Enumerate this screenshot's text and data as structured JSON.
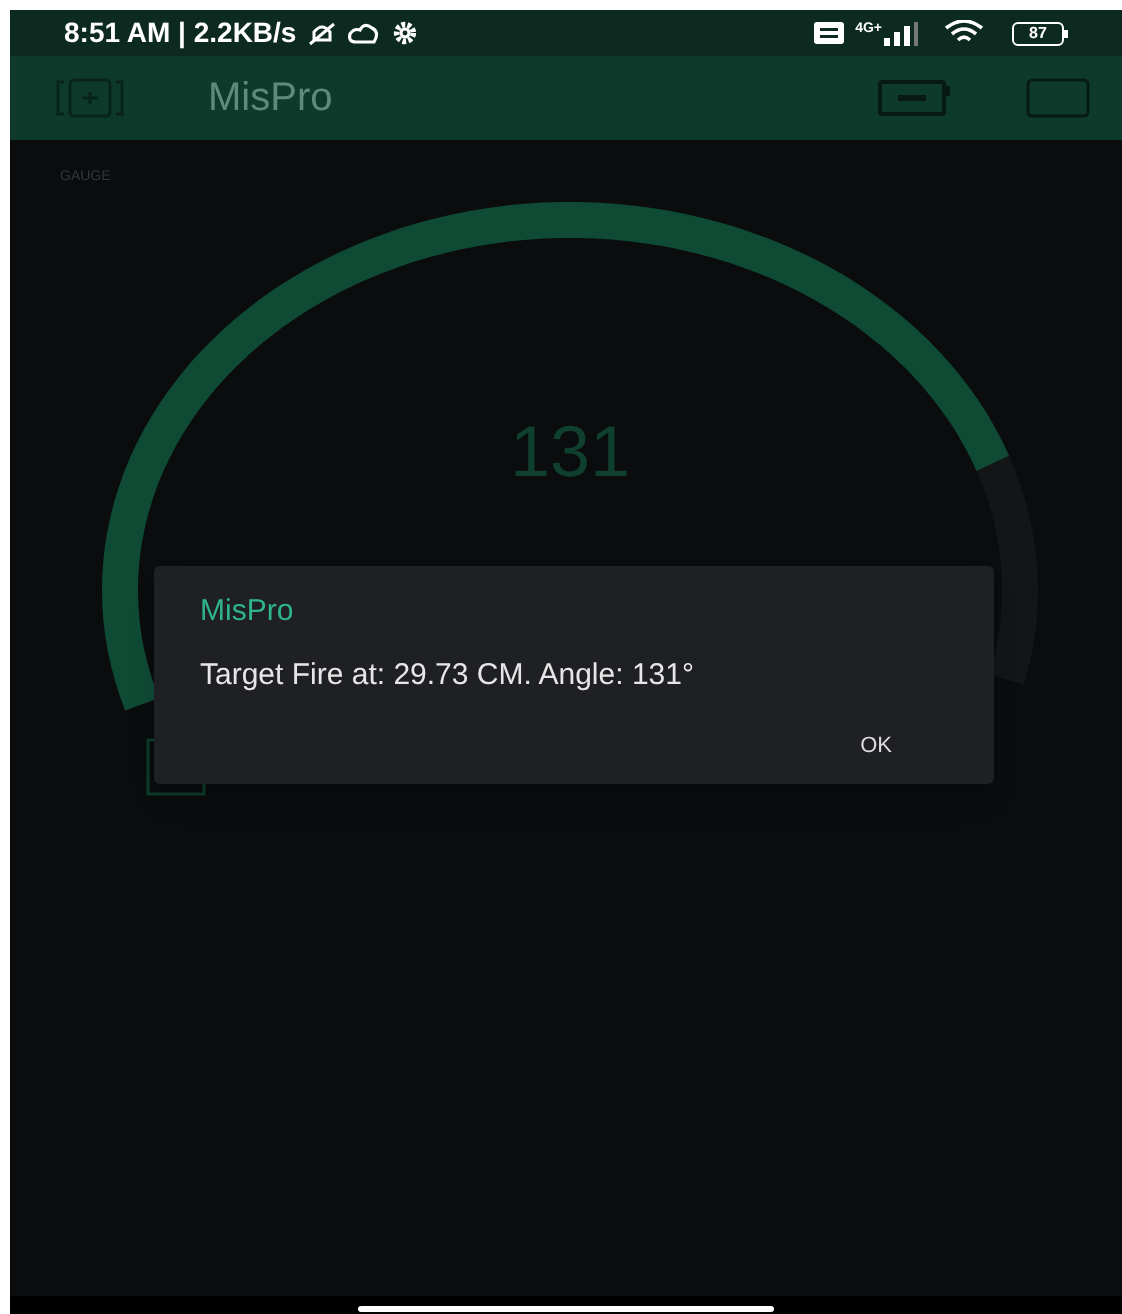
{
  "status_bar": {
    "time": "8:51 AM | 2.2KB/s",
    "network": "4G+",
    "battery": "87"
  },
  "app_bar": {
    "title": "MisPro"
  },
  "gauge": {
    "label": "GAUGE",
    "value": "131"
  },
  "dialog": {
    "title": "MisPro",
    "message": "Target Fire at: 29.73 CM. Angle: 131°",
    "button": "OK"
  }
}
